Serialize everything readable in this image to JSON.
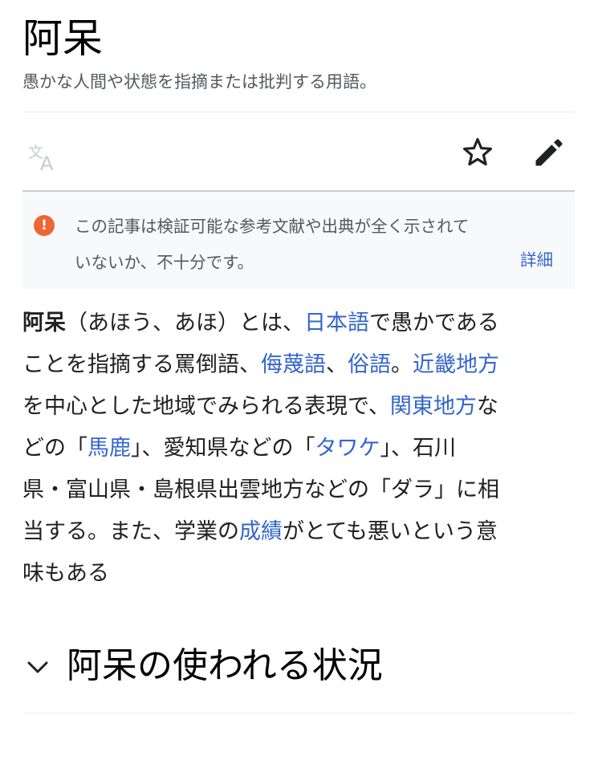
{
  "page": {
    "title": "阿呆",
    "description": "愚かな人間や状態を指摘または批判する用語。"
  },
  "toolbar": {
    "language_icon": "translate-icon",
    "watch_icon": "star-icon",
    "edit_icon": "pencil-icon"
  },
  "notice": {
    "icon": "exclamation-icon",
    "line1": "この記事は検証可能な参考文献や出典が全く示されて",
    "line2": "いないか、不十分です。",
    "more_label": "詳細"
  },
  "article": {
    "l1_bold": "阿呆",
    "l1_text": "（あほう、あほ）とは、",
    "l1_link": "日本語",
    "l1_tail": "で愚かである",
    "l2_text": "ことを指摘する罵倒語、",
    "l2_link1": "侮蔑語",
    "l2_sep1": "、",
    "l2_link2": "俗語",
    "l2_sep2": "。",
    "l2_link3": "近畿地方",
    "l3_text": "を中心とした地域でみられる表現で、",
    "l3_link": "関東地方",
    "l3_tail": "な",
    "l4_text": "どの「",
    "l4_link1": "馬鹿",
    "l4_mid": "」、愛知県などの「",
    "l4_link2": "タワケ",
    "l4_tail": "」、石川",
    "l5_text": "県・富山県・島根県出雲地方などの「ダラ」に相",
    "l6_text": "当する。また、学業の",
    "l6_link": "成績",
    "l6_tail": "がとても悪いという意",
    "l7_text": "味もある"
  },
  "section": {
    "icon": "chevron-down-icon",
    "title": "阿呆の使われる状況"
  },
  "colors": {
    "link": "#3366cc",
    "notice_icon": "#ee6633",
    "notice_bg": "#f8f9fa",
    "text": "#202122",
    "muted": "#54595d"
  }
}
